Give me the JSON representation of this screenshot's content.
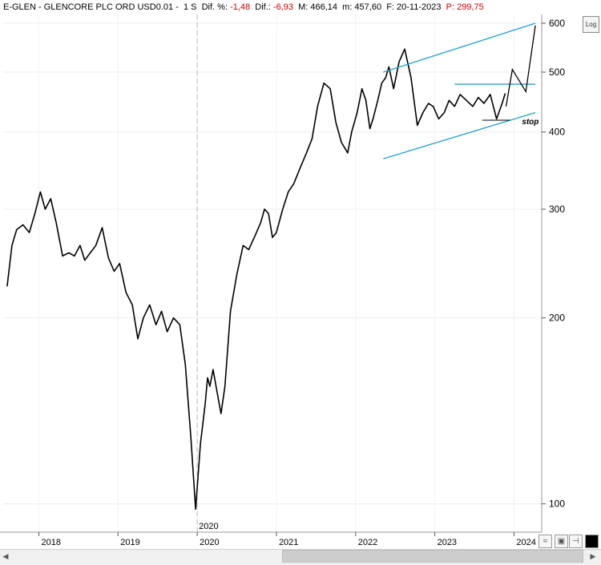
{
  "header": {
    "symbol": "E-GLEN - GLENCORE PLC ORD USD0.01 -",
    "timeframe": "1 S",
    "dif_pct_label": "Dif. %:",
    "dif_pct_value": "-1,48",
    "dif_label": "Dif.:",
    "dif_value": "-6,93",
    "max_label": "M: 466,14",
    "min_label": "m: 457,60",
    "date_label": "F: 20-11-2023",
    "price_label": "P: 299,75"
  },
  "log_button": "Log",
  "toolbar": {
    "save_icon": "save-icon",
    "pin_icon": "pin-icon",
    "color_icon": "color-square-icon"
  },
  "chart_data": {
    "type": "line",
    "title": "",
    "ylabel": "",
    "xlabel": "",
    "y_scale": "log",
    "ylim": [
      90,
      620
    ],
    "xlim": [
      2017.55,
      2024.35
    ],
    "y_ticks": [
      100,
      200,
      300,
      400,
      500,
      600
    ],
    "y_tick_labels": [
      "100",
      "200",
      "300",
      "400",
      "500",
      "600"
    ],
    "x_ticks": [
      2018,
      2019,
      2020,
      2021,
      2022,
      2023,
      2024
    ],
    "x_tick_labels": [
      "2018",
      "2019",
      "2020",
      "2021",
      "2022",
      "2023",
      "2024"
    ],
    "vline_label": "2020",
    "vline_x": 2020.0,
    "grid": true,
    "series": [
      {
        "x": [
          2017.6,
          2017.66,
          2017.72,
          2017.8,
          2017.88,
          2017.95,
          2018.02,
          2018.08,
          2018.15,
          2018.22,
          2018.3,
          2018.38,
          2018.45,
          2018.52,
          2018.58,
          2018.65,
          2018.72,
          2018.8,
          2018.88,
          2018.95,
          2019.02,
          2019.1,
          2019.18,
          2019.25,
          2019.32,
          2019.4,
          2019.48,
          2019.55,
          2019.62,
          2019.7,
          2019.78,
          2019.85,
          2019.92,
          2019.98,
          2020.04,
          2020.1,
          2020.13,
          2020.16,
          2020.2,
          2020.25,
          2020.3,
          2020.35,
          2020.42,
          2020.5,
          2020.58,
          2020.65,
          2020.72,
          2020.8,
          2020.85,
          2020.9,
          2020.95,
          2021.0,
          2021.08,
          2021.15,
          2021.22,
          2021.3,
          2021.38,
          2021.45,
          2021.52,
          2021.6,
          2021.68,
          2021.75,
          2021.82,
          2021.9,
          2021.95,
          2022.02,
          2022.08,
          2022.13,
          2022.18,
          2022.22,
          2022.28,
          2022.33,
          2022.38,
          2022.42,
          2022.48,
          2022.55,
          2022.62,
          2022.7,
          2022.78,
          2022.85,
          2022.92,
          2022.98,
          2023.05,
          2023.12,
          2023.18,
          2023.25,
          2023.32,
          2023.4,
          2023.48,
          2023.55,
          2023.62,
          2023.7,
          2023.78,
          2023.85,
          2023.89
        ],
        "values": [
          225,
          262,
          278,
          283,
          275,
          295,
          320,
          300,
          312,
          285,
          252,
          255,
          252,
          262,
          248,
          255,
          262,
          280,
          250,
          238,
          245,
          220,
          210,
          185,
          200,
          210,
          195,
          205,
          190,
          200,
          195,
          168,
          128,
          98,
          125,
          145,
          160,
          155,
          165,
          152,
          140,
          155,
          205,
          235,
          262,
          258,
          270,
          285,
          300,
          295,
          270,
          275,
          300,
          320,
          330,
          350,
          370,
          390,
          440,
          480,
          470,
          415,
          385,
          370,
          400,
          430,
          470,
          450,
          405,
          420,
          450,
          480,
          490,
          510,
          470,
          520,
          545,
          490,
          410,
          430,
          445,
          440,
          420,
          430,
          450,
          440,
          460,
          450,
          440,
          455,
          445,
          460,
          420,
          445,
          462
        ]
      }
    ],
    "annotations": {
      "channel_upper": [
        [
          2022.35,
          500
        ],
        [
          2024.27,
          600
        ]
      ],
      "channel_lower": [
        [
          2022.35,
          362
        ],
        [
          2024.27,
          430
        ]
      ],
      "resistance": [
        [
          2023.25,
          478
        ],
        [
          2024.27,
          478
        ]
      ],
      "support": [
        [
          2023.6,
          418
        ],
        [
          2023.95,
          418
        ]
      ],
      "projection": [
        [
          2023.9,
          440
        ],
        [
          2023.98,
          505
        ],
        [
          2024.15,
          465
        ],
        [
          2024.27,
          595
        ]
      ],
      "stop_label": "stop",
      "stop_point": [
        2024.1,
        412
      ]
    }
  }
}
